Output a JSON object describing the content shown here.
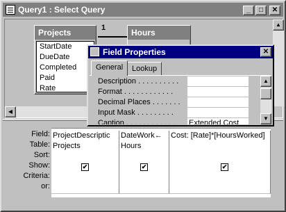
{
  "window": {
    "title": "Query1 : Select Query"
  },
  "tables": [
    {
      "name": "Projects",
      "fields": [
        "StartDate",
        "DueDate",
        "Completed",
        "Paid",
        "Rate"
      ]
    },
    {
      "name": "Hours",
      "fields": [
        ""
      ]
    }
  ],
  "join": {
    "one_label": "1"
  },
  "dialog": {
    "title": "Field Properties",
    "tabs": [
      "General",
      "Lookup"
    ],
    "properties": [
      {
        "label": "Description . . . . . . . . . .",
        "value": ""
      },
      {
        "label": "Format . . . . . . . . . . . .",
        "value": ""
      },
      {
        "label": "Decimal Places . . . . . . .",
        "value": ""
      },
      {
        "label": "Input Mask . . . . . . . . .",
        "value": ""
      },
      {
        "label": "Caption . . . . . . . . . . . .",
        "value": "Extended Cost"
      }
    ]
  },
  "grid": {
    "row_labels": [
      "Field:",
      "Table:",
      "Sort:",
      "Show:",
      "Criteria:",
      "or:"
    ],
    "columns": [
      {
        "field": "ProjectDescriptic",
        "table": "Projects",
        "show": true
      },
      {
        "field": "DateWork←",
        "table": "Hours",
        "show": true
      },
      {
        "field": "Cost: [Rate]*[HoursWorked]",
        "table": "",
        "show": true
      },
      {
        "field": "",
        "table": "",
        "show": false
      }
    ]
  }
}
